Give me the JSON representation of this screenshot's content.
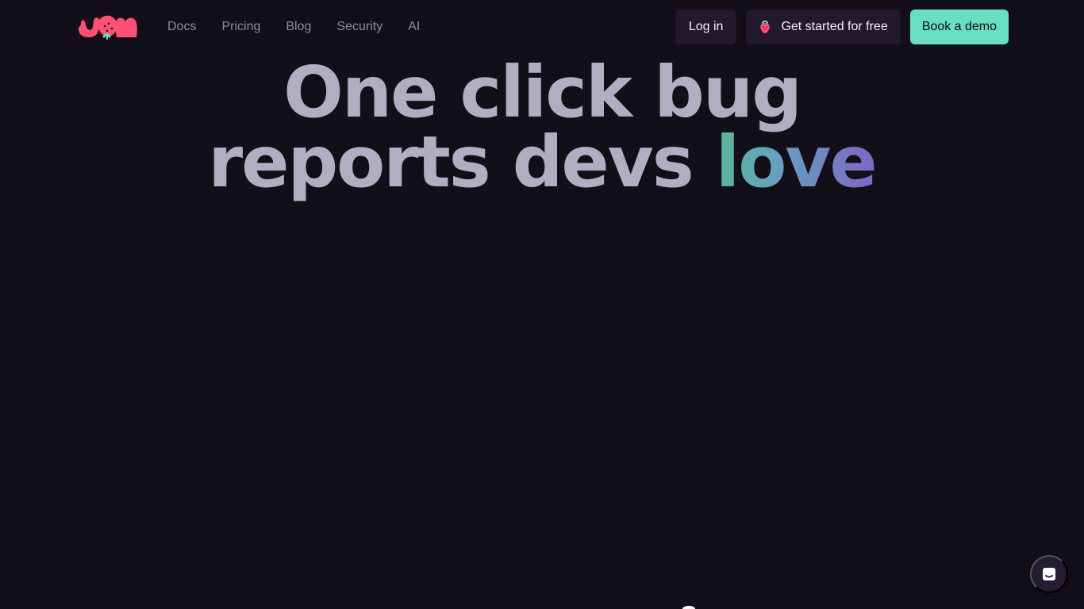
{
  "nav": {
    "logo_alt": "jam",
    "links": [
      {
        "label": "Docs"
      },
      {
        "label": "Pricing"
      },
      {
        "label": "Blog"
      },
      {
        "label": "Security"
      },
      {
        "label": "AI"
      }
    ],
    "actions": {
      "login": "Log in",
      "get_started": "Get started for free",
      "book_demo": "Book a demo"
    }
  },
  "hero": {
    "line1": "One click bug",
    "line2_prefix": "reports devs",
    "line2_highlight": "love"
  },
  "colors": {
    "background": "#120f19",
    "accent_teal": "#67dfc0",
    "logo_pink": "#ff4f74"
  },
  "icons": {
    "logo": "jam-logo",
    "get_started": "strawberry-icon",
    "chat": "chat-icon"
  }
}
